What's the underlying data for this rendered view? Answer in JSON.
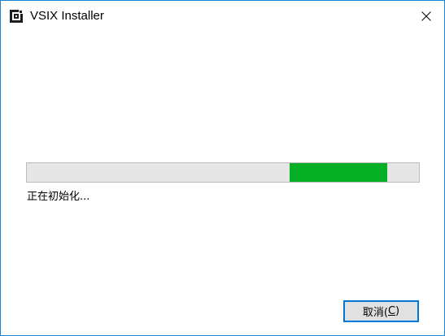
{
  "window": {
    "title": "VSIX Installer",
    "app_icon": "vsix-installer-icon",
    "close_icon": "close-icon"
  },
  "progress": {
    "status": "正在初始化...",
    "indeterminate": true,
    "fill_start_fraction": 0.67,
    "fill_end_fraction": 0.92,
    "fill_color": "#06b025",
    "track_color": "#e6e6e6"
  },
  "actions": {
    "cancel_prefix": "取消(",
    "cancel_accesskey": "C",
    "cancel_suffix": ")"
  }
}
